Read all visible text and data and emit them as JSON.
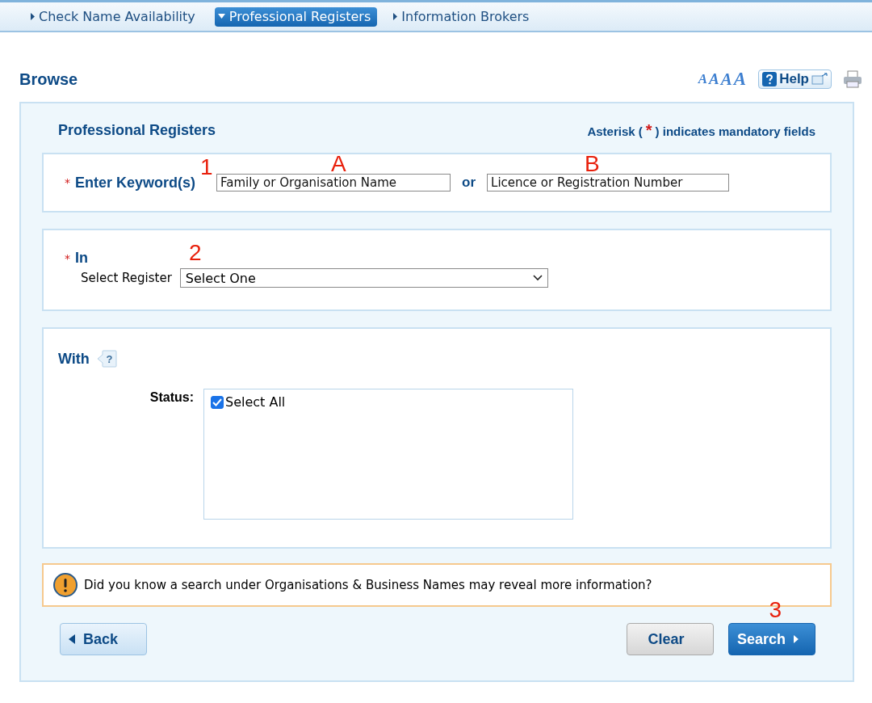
{
  "tabs": [
    {
      "label": "Check Name Availability",
      "selected": false
    },
    {
      "label": "Professional Registers",
      "selected": true
    },
    {
      "label": "Information Brokers",
      "selected": false
    }
  ],
  "page_title": "Browse",
  "font_sizes": [
    "A",
    "A",
    "A",
    "A"
  ],
  "help_button": "Help",
  "panel": {
    "title": "Professional Registers",
    "mandatory_note_before": "Asterisk (",
    "mandatory_star": "*",
    "mandatory_note_after": ") indicates mandatory fields"
  },
  "keyword": {
    "required_mark": "*",
    "label": "Enter Keyword(s)",
    "name_field": {
      "placeholder": "Family or Organisation Name"
    },
    "or": "or",
    "number_field": {
      "placeholder": "Licence or Registration Number"
    }
  },
  "register": {
    "required_mark": "*",
    "label": "In",
    "select_label": "Select Register",
    "select_value": "Select One"
  },
  "with": {
    "label": "With",
    "help_mark": "?",
    "status_label": "Status:",
    "options": [
      {
        "label": "Select All",
        "checked": true
      }
    ]
  },
  "notice": "Did you know a search under Organisations & Business Names may reveal more information?",
  "buttons": {
    "back": "Back",
    "clear": "Clear",
    "search": "Search"
  },
  "annotations": {
    "keyword": "1",
    "name_field": "A",
    "number_field": "B",
    "register": "2",
    "search": "3"
  }
}
